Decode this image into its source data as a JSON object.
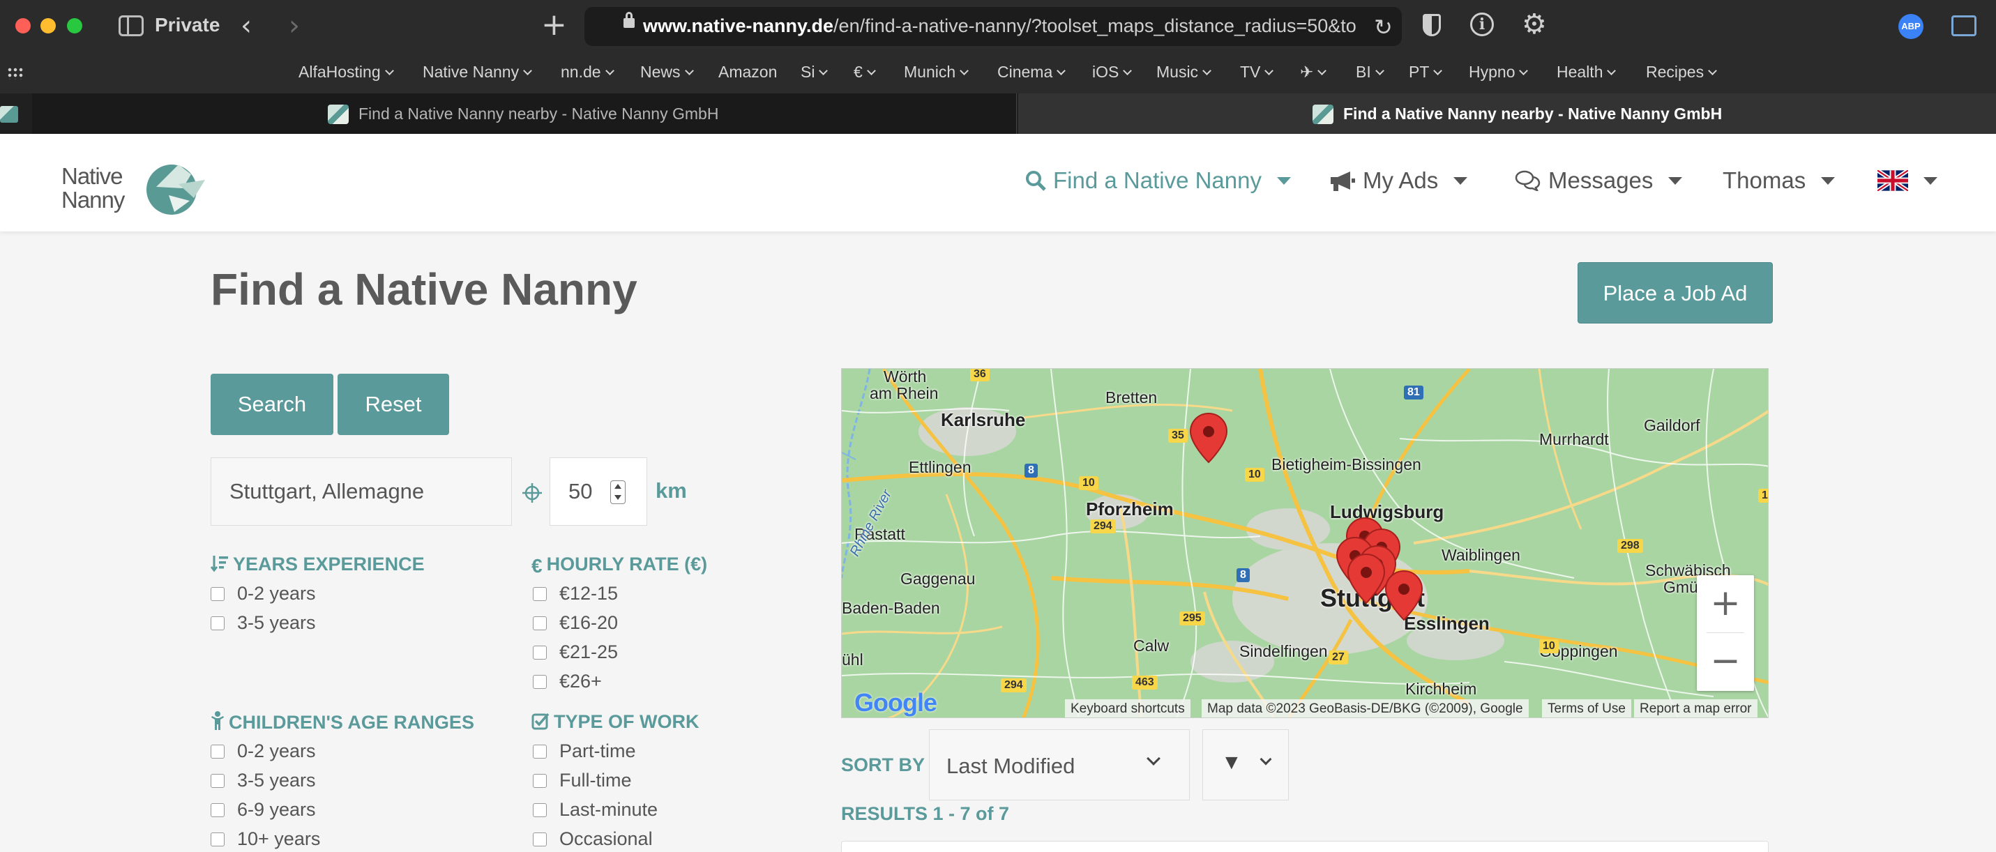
{
  "browser": {
    "private_label": "Private",
    "url_host": "www.native-nanny.de",
    "url_path": "/en/find-a-native-nanny/?toolset_maps_distance_radius=50&to",
    "tabs": [
      {
        "title": "Find a Native Nanny nearby - Native Nanny GmbH",
        "active": false
      },
      {
        "title": "Find a Native Nanny nearby - Native Nanny GmbH",
        "active": true
      }
    ],
    "bookmarks": [
      "AlfaHosting",
      "Native Nanny",
      "nn.de",
      "News",
      "Amazon",
      "Si",
      "€",
      "Munich",
      "Cinema",
      "iOS",
      "Music",
      "TV",
      "✈",
      "BI",
      "PT",
      "Hypno",
      "Health",
      "Recipes"
    ],
    "abp_label": "ABP"
  },
  "site": {
    "logo_line1": "Native",
    "logo_line2": "Nanny",
    "brand_color": "#5a9a9b",
    "nav": {
      "find": "Find a Native Nanny",
      "ads": "My Ads",
      "messages": "Messages",
      "user": "Thomas"
    }
  },
  "page": {
    "title": "Find a Native Nanny",
    "job_ad_button": "Place a Job Ad",
    "search_button": "Search",
    "reset_button": "Reset",
    "location_value": "Stuttgart, Allemagne",
    "radius_value": "50",
    "radius_unit": "km"
  },
  "filters": {
    "experience": {
      "heading": "YEARS EXPERIENCE",
      "options": [
        "0-2 years",
        "3-5 years"
      ]
    },
    "rate": {
      "heading": "HOURLY RATE (€)",
      "options": [
        "€12-15",
        "€16-20",
        "€21-25",
        "€26+"
      ]
    },
    "ages": {
      "heading": "CHILDREN'S AGE RANGES",
      "options": [
        "0-2 years",
        "3-5 years",
        "6-9 years",
        "10+ years"
      ]
    },
    "work": {
      "heading": "TYPE OF WORK",
      "options": [
        "Part-time",
        "Full-time",
        "Last-minute",
        "Occasional"
      ]
    }
  },
  "map": {
    "cities": {
      "worth": "Wörth",
      "am_rhein": "am Rhein",
      "karlsruhe": "Karlsruhe",
      "bretten": "Bretten",
      "ettlingen": "Ettlingen",
      "bietigheim": "Bietigheim-Bissingen",
      "murrhardt": "Murrhardt",
      "gaildorf": "Gaildorf",
      "rastatt": "Rastatt",
      "pforzheim": "Pforzheim",
      "ludwigsburg": "Ludwigsburg",
      "waiblingen": "Waiblingen",
      "schwabisch": "Schwäbisch",
      "gmu": "Gmü",
      "gaggenau": "Gaggenau",
      "stuttgart": "Stuttgart",
      "baden_baden": "Baden-Baden",
      "esslingen": "Esslingen",
      "calw": "Calw",
      "sindelfingen": "Sindelfingen",
      "goppingen": "Göppingen",
      "kirchheim": "Kirchheim",
      "buhl": "ühl",
      "rhine": "Rhine River"
    },
    "roads": {
      "r36": "36",
      "r81": "81",
      "r35": "35",
      "r8a": "8",
      "r10a": "10",
      "r10b": "10",
      "r294a": "294",
      "r298": "298",
      "r8b": "8",
      "r295": "295",
      "r10c": "10",
      "r27": "27",
      "r463": "463",
      "r294b": "294",
      "r1": "1"
    },
    "google_label": "Google",
    "keyboard_shortcuts": "Keyboard shortcuts",
    "map_data": "Map data ©2023 GeoBasis-DE/BKG (©2009), Google",
    "terms": "Terms of Use",
    "report": "Report a map error",
    "zoom_in": "+",
    "zoom_out": "−"
  },
  "results": {
    "sort_label": "SORT BY",
    "sort_value": "Last Modified",
    "order_value": "▼",
    "count_text": "RESULTS 1 - 7 of 7"
  }
}
